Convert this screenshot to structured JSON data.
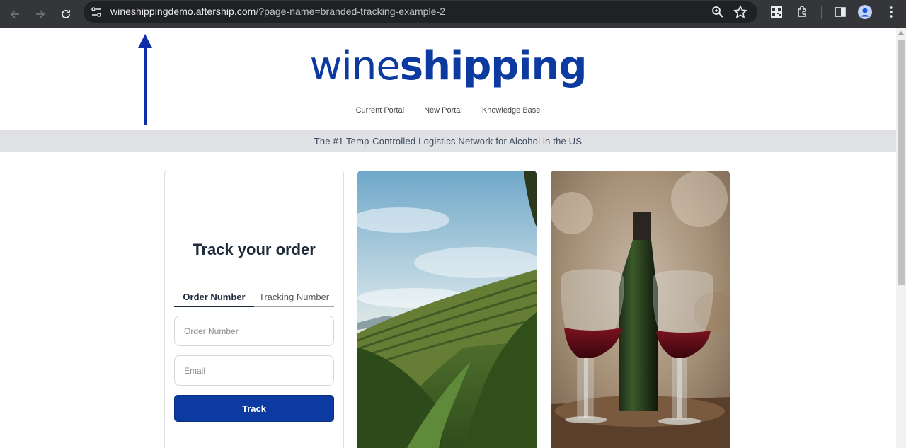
{
  "browser": {
    "url_host": "wineshippingdemo.aftership.com",
    "url_path": "/?page-name=branded-tracking-example-2",
    "icons": [
      "back-icon",
      "forward-icon",
      "reload-icon",
      "site-settings-icon",
      "zoom-icon",
      "bookmark-star-icon",
      "qr-code-icon",
      "extensions-icon",
      "side-panel-icon",
      "profile-icon",
      "menu-icon"
    ]
  },
  "header": {
    "logo_light": "wine",
    "logo_bold": "shipping",
    "brand_color": "#0d3aa0",
    "nav": [
      "Current Portal",
      "New Portal",
      "Knowledge Base"
    ]
  },
  "banner": {
    "text": "The #1 Temp-Controlled Logistics Network for Alcohol in the US"
  },
  "tracker": {
    "title": "Track your order",
    "tabs": [
      "Order Number",
      "Tracking Number"
    ],
    "active_tab": "Order Number",
    "order_placeholder": "Order Number",
    "email_placeholder": "Email",
    "button_label": "Track"
  }
}
